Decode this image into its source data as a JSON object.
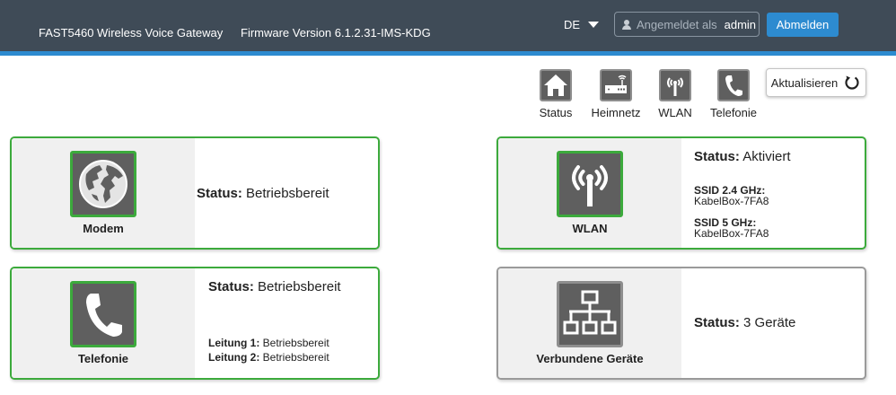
{
  "header": {
    "product": "FAST5460 Wireless Voice Gateway",
    "firmware": "Firmware Version 6.1.2.31-IMS-KDG",
    "language": "DE",
    "login_label": "Angemeldet als",
    "login_user": "admin",
    "logout_label": "Abmelden"
  },
  "nav": {
    "items": [
      {
        "label": "Status",
        "icon": "home-icon"
      },
      {
        "label": "Heimnetz",
        "icon": "router-icon"
      },
      {
        "label": "WLAN",
        "icon": "wifi-antenna-icon"
      },
      {
        "label": "Telefonie",
        "icon": "phone-icon"
      }
    ],
    "refresh_label": "Aktualisieren"
  },
  "cards": {
    "modem": {
      "title": "Modem",
      "status_label": "Status:",
      "status_value": "Betriebsbereit",
      "icon": "globe-icon"
    },
    "wlan": {
      "title": "WLAN",
      "status_label": "Status:",
      "status_value": "Aktiviert",
      "ssid24_label": "SSID 2.4 GHz:",
      "ssid24_value": "KabelBox-7FA8",
      "ssid5_label": "SSID 5 GHz:",
      "ssid5_value": "KabelBox-7FA8",
      "icon": "wifi-antenna-icon"
    },
    "telefonie": {
      "title": "Telefonie",
      "status_label": "Status:",
      "status_value": "Betriebsbereit",
      "line1_label": "Leitung 1:",
      "line1_value": "Betriebsbereit",
      "line2_label": "Leitung 2:",
      "line2_value": "Betriebsbereit",
      "icon": "phone-icon"
    },
    "devices": {
      "title": "Verbundene Geräte",
      "status_label": "Status:",
      "status_value": "3 Geräte",
      "icon": "network-icon"
    }
  },
  "colors": {
    "header_bg": "#3f4b57",
    "accent_blue": "#2d8bd0",
    "status_green": "#3caa3c",
    "inactive_grey": "#9a9a9a"
  }
}
